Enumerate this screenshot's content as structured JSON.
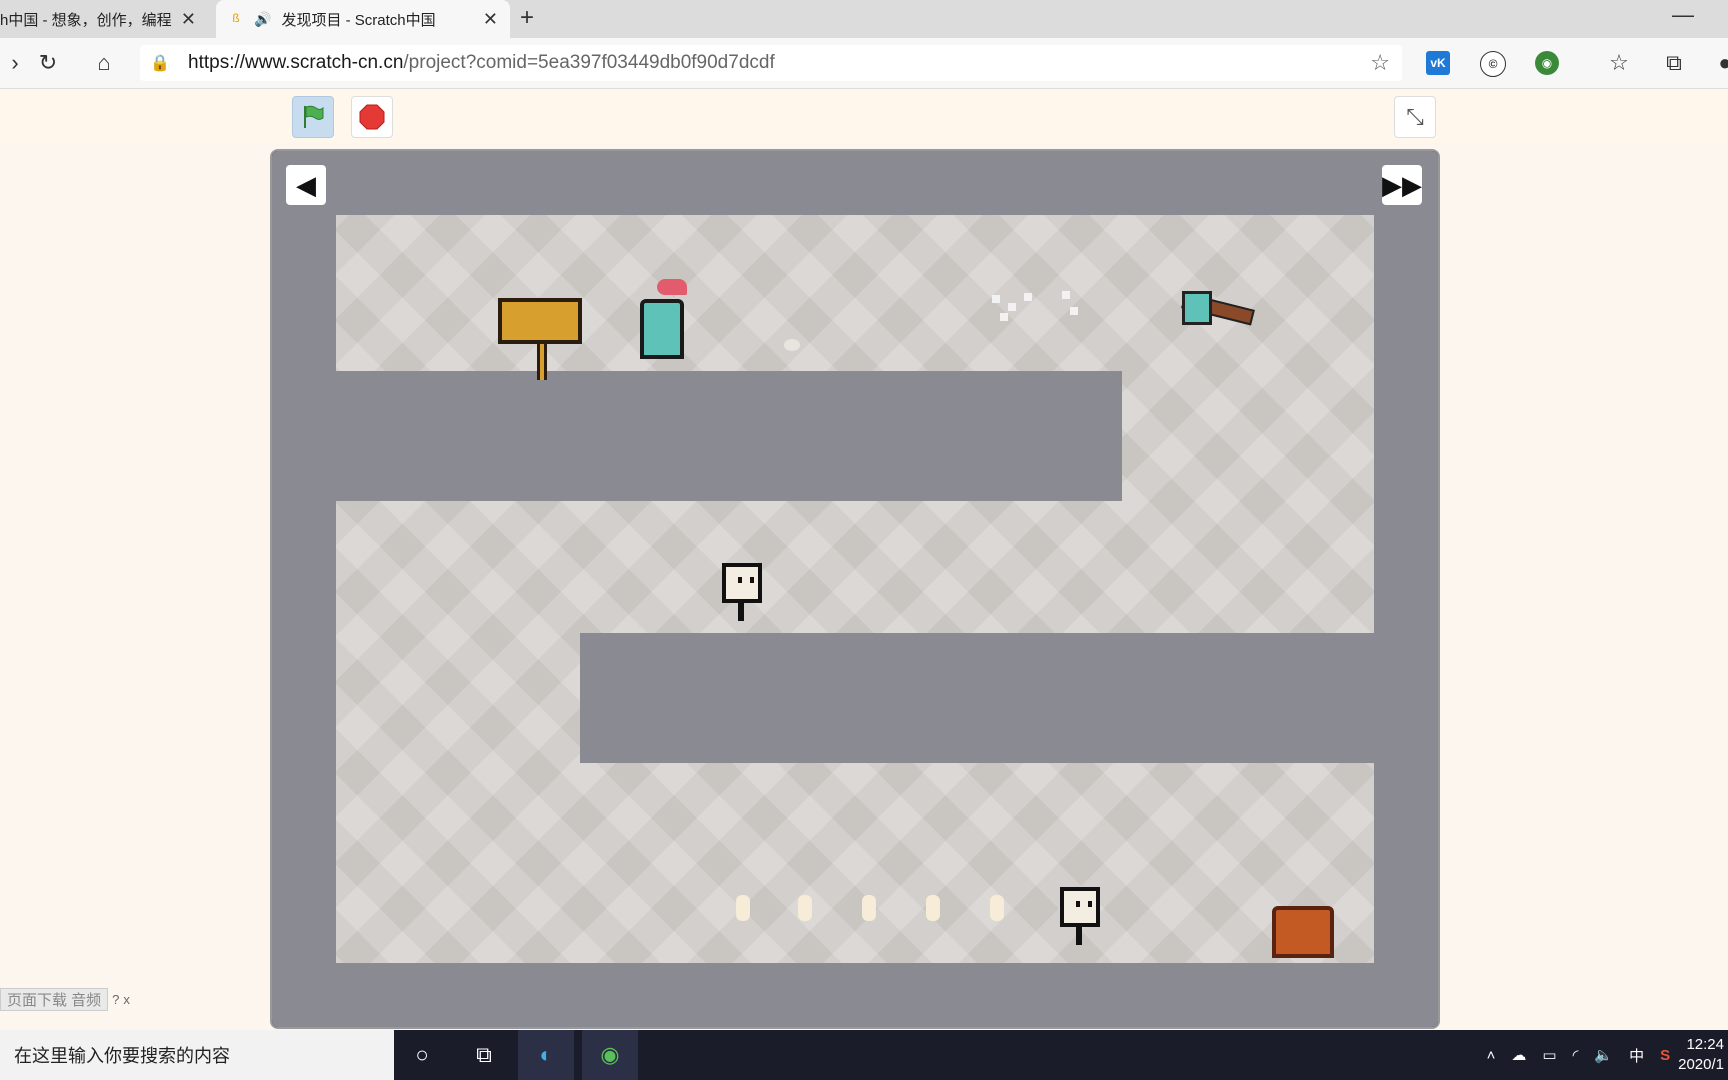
{
  "tabs": [
    {
      "title": "h中国 - 想象，创作，编程",
      "favicon": "scratch-icon"
    },
    {
      "title": "发现项目 - Scratch中国",
      "favicon": "scratch-icon",
      "audio": "speaker-icon",
      "active": true
    }
  ],
  "toolbar": {
    "url_prefix": "https://www.scratch-cn.cn",
    "url_rest": "/project?comid=5ea397f03449db0f90d7dcdf"
  },
  "overlay": {
    "download_text": "页面下载 音频",
    "help": "?",
    "close": "x"
  },
  "taskbar": {
    "search_placeholder": "在这里输入你要搜索的内容",
    "ime": "中",
    "time": "12:24",
    "date": "2020/1"
  },
  "colors": {
    "accent_flag": "#4caf50",
    "stop": "#e53935",
    "wall": "#1e1b26",
    "floor": "#c9c5c1"
  }
}
